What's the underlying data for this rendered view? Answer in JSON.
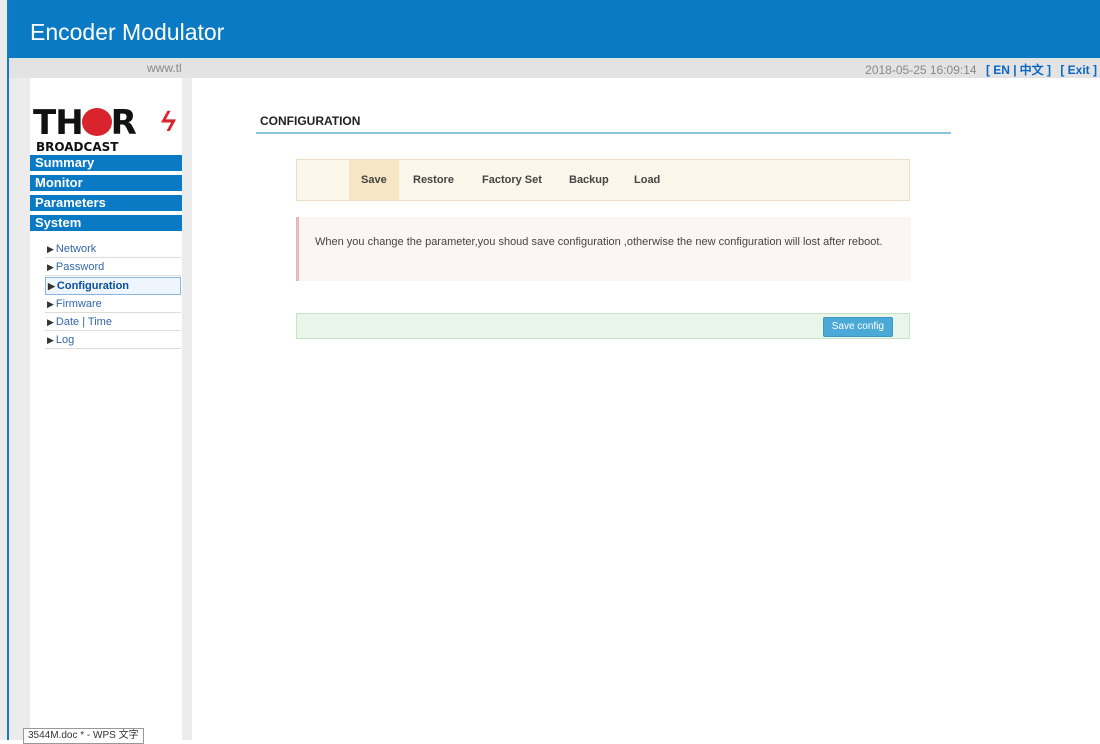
{
  "header": {
    "title": "Encoder Modulator"
  },
  "subbar": {
    "url": "www.tl",
    "datetime": "2018-05-25 16:09:14",
    "lang_en": "[ EN |",
    "lang_zh": "中文 ]",
    "exit": "[ Exit ]"
  },
  "logo": {
    "brand_left": "TH",
    "brand_right": "R",
    "sub": "BROADCAST",
    "bolt": "ϟ"
  },
  "menu": {
    "summary": "Summary",
    "monitor": "Monitor",
    "parameters": "Parameters",
    "system": "System"
  },
  "submenu": {
    "network": "Network",
    "password": "Password",
    "configuration": "Configuration",
    "firmware": "Firmware",
    "datetime": "Date | Time",
    "log": "Log"
  },
  "page": {
    "title": "CONFIGURATION",
    "tabs": [
      "Save",
      "Restore",
      "Factory Set",
      "Backup",
      "Load"
    ],
    "selected_tab": "Save",
    "alert": "When you change the parameter,you shoud save configuration ,otherwise the new configuration will lost after reboot.",
    "save_button": "Save config"
  },
  "taskbar": {
    "tip": "3544M.doc * - WPS 文字"
  },
  "colors": {
    "accent": "#0a7ac4",
    "toolbar": "#fbf6ea",
    "alert": "#fdf4f4",
    "footer": "#eaf5ea",
    "button": "#4ba9d8"
  }
}
